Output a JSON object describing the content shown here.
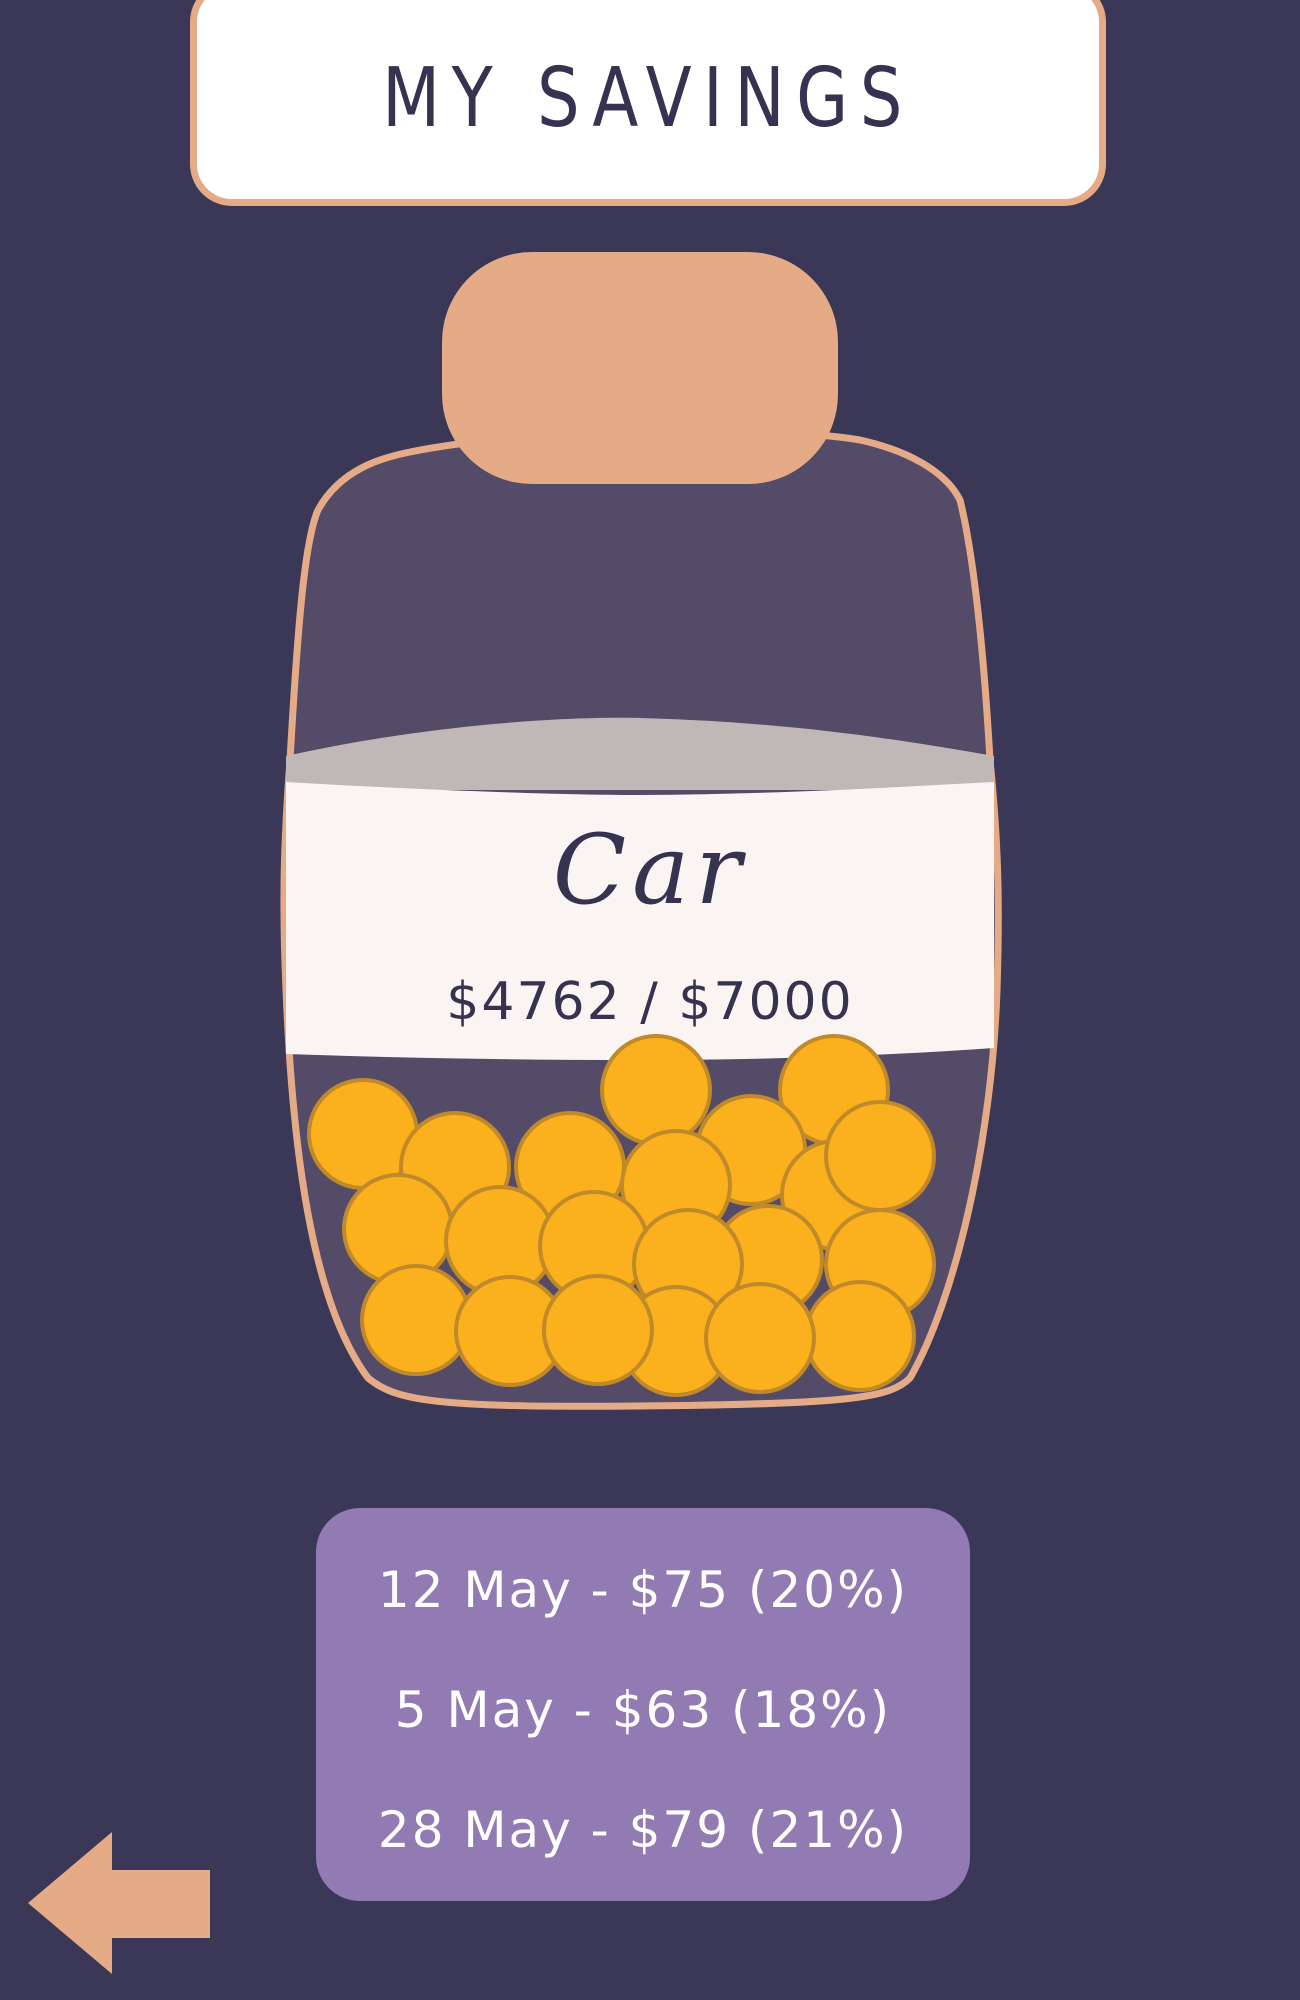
{
  "header": {
    "title": "MY SAVINGS"
  },
  "jar": {
    "name": "Car",
    "progress_text": "$4762 / $7000",
    "saved": 4762,
    "goal": 7000
  },
  "history": {
    "entries": [
      "12 May - $75 (20%)",
      "5 May - $63 (18%)",
      "28 May - $79 (21%)"
    ]
  },
  "navigation": {
    "back_icon": "arrow-left-icon"
  },
  "colors": {
    "background": "#3a3757",
    "accent": "#e5ab86",
    "coin": "#fbb11d",
    "panel": "#927bb3"
  }
}
